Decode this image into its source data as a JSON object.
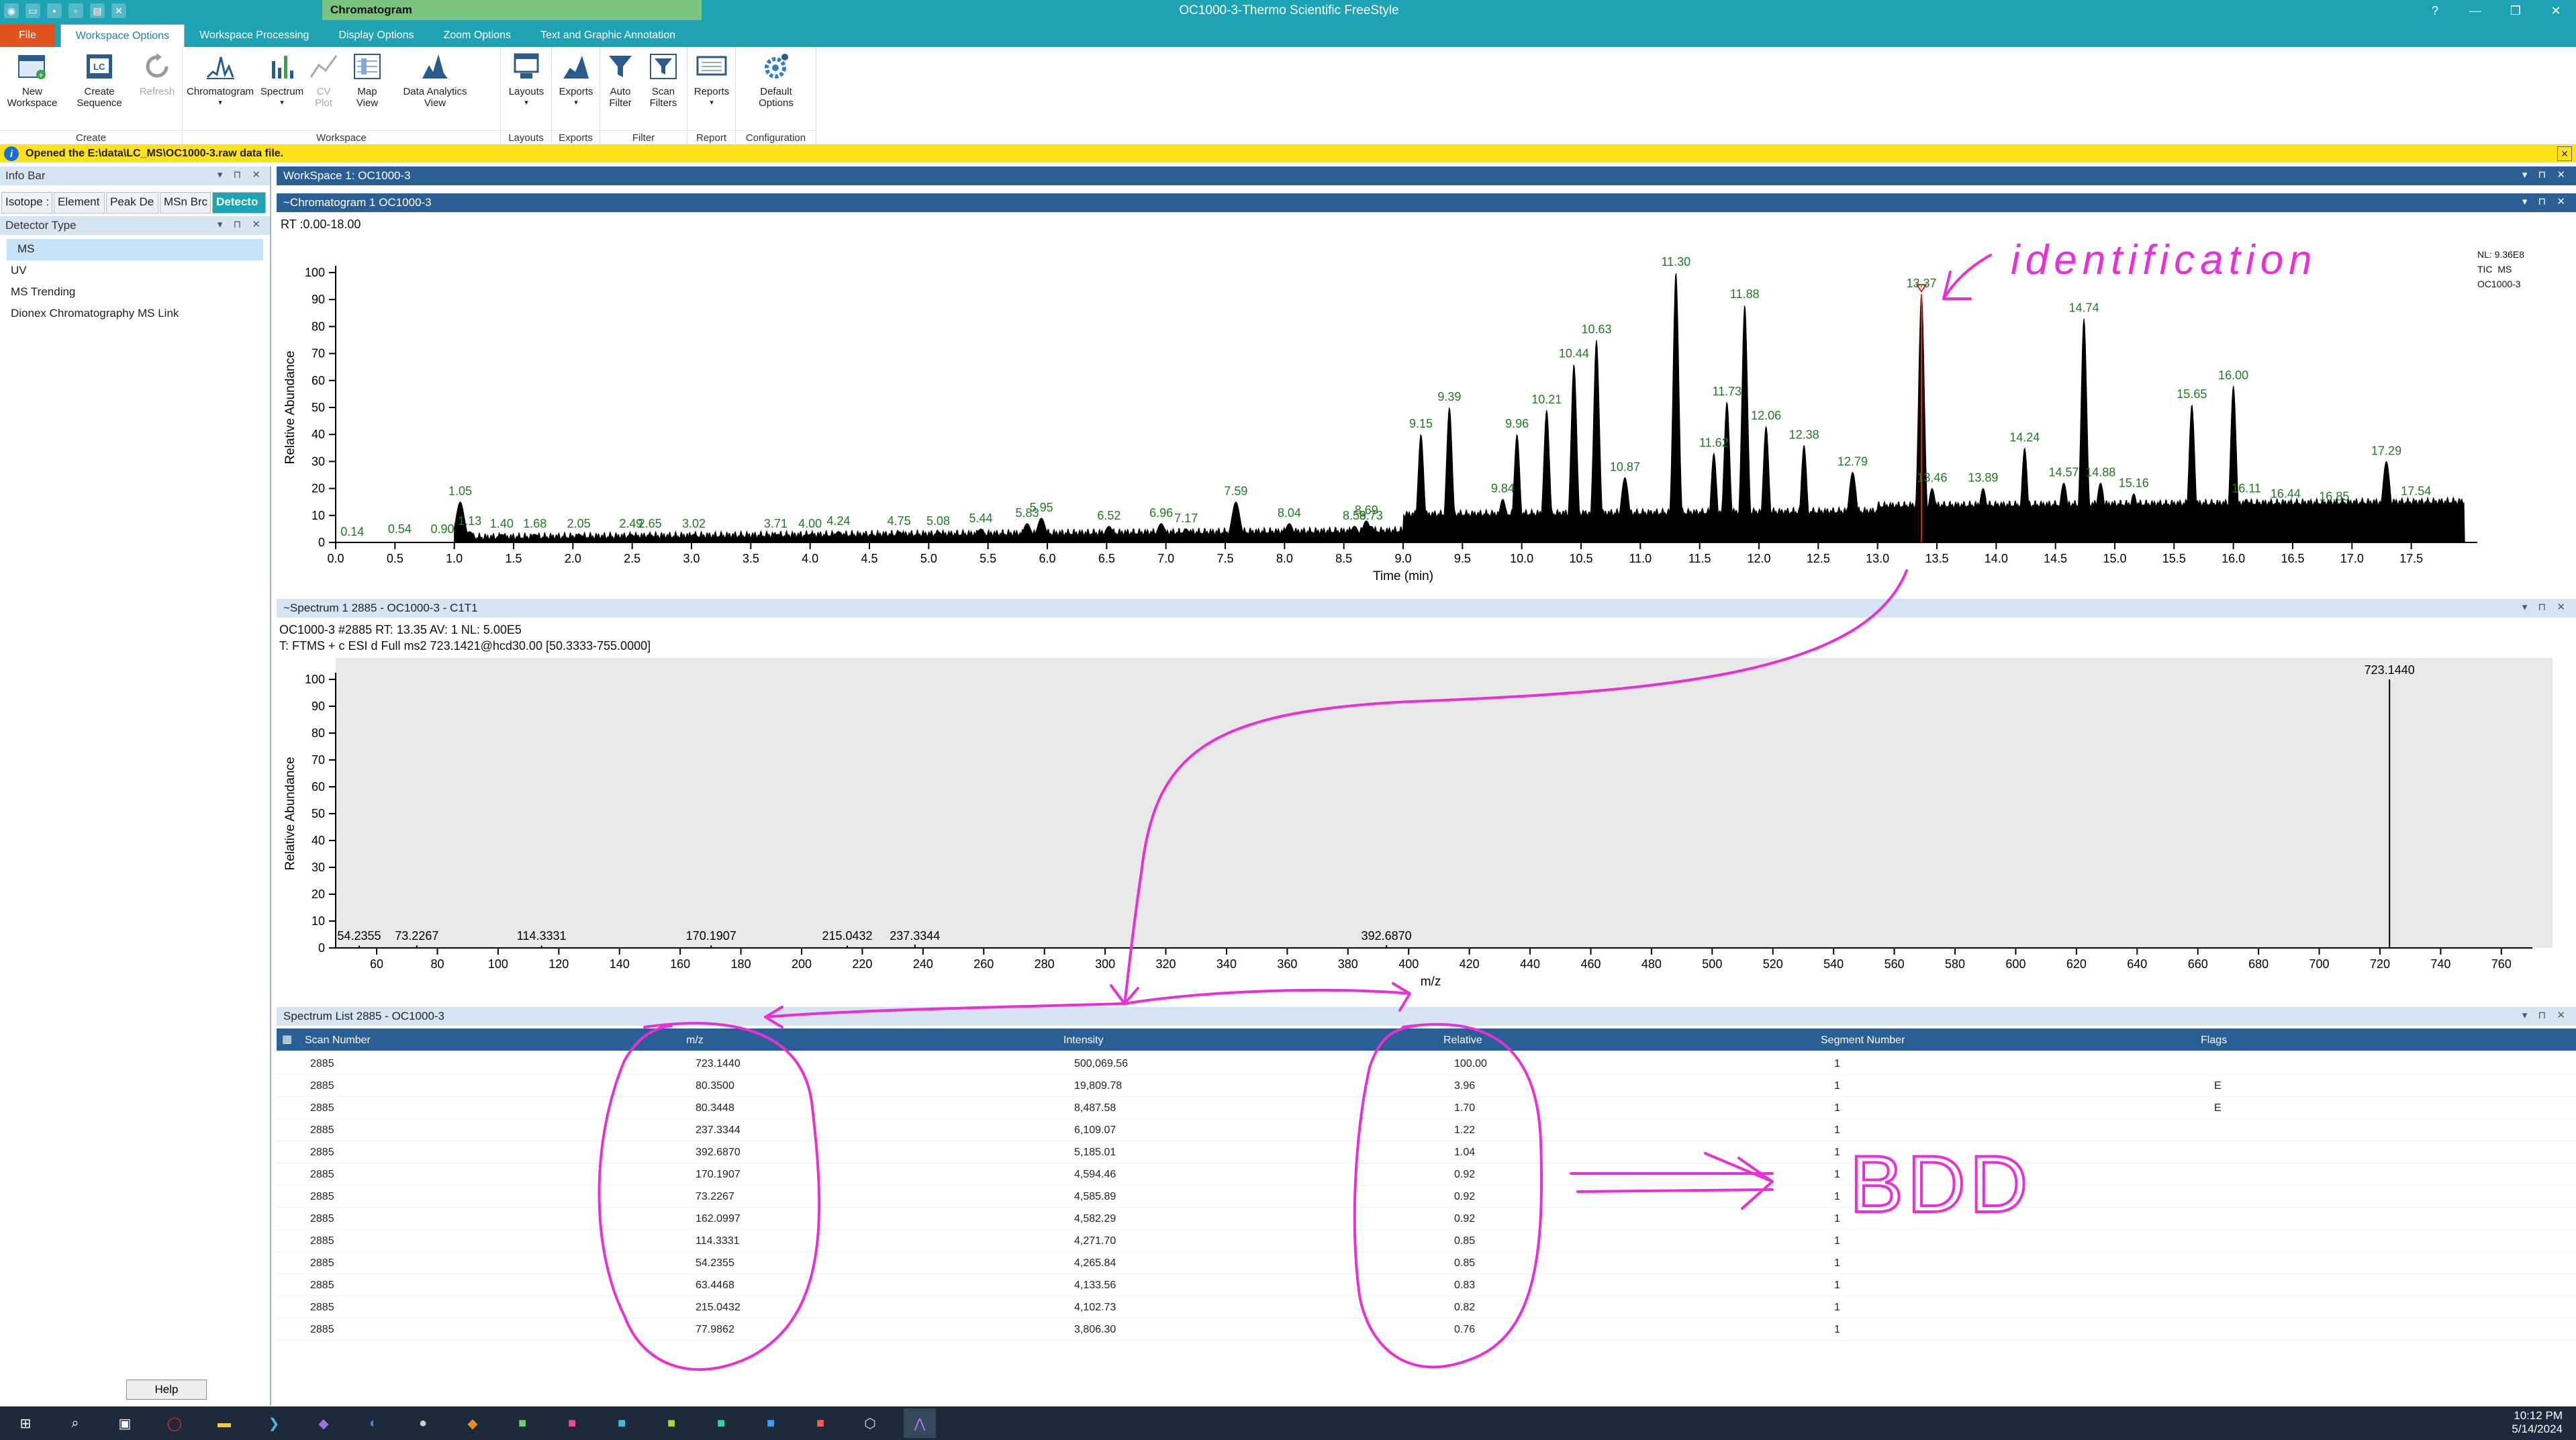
{
  "titlebar": {
    "app_title": "OC1000-3-Thermo Scientific FreeStyle",
    "context_tab": "Chromatogram",
    "quick_access": [
      "app-icon",
      "open-icon",
      "save-icon",
      "save-as-icon",
      "print-icon",
      "tools-icon"
    ]
  },
  "ribbon_tabs": [
    "File",
    "Workspace Options",
    "Workspace Processing",
    "Display Options",
    "Zoom Options",
    "Text and Graphic Annotation"
  ],
  "ribbon": {
    "buttons": {
      "new_workspace": "New\nWorkspace",
      "create_sequence": "Create\nSequence",
      "refresh": "Refresh",
      "chromatogram": "Chromatogram",
      "spectrum": "Spectrum",
      "cv_plot": "CV\nPlot",
      "map_view": "Map\nView",
      "data_analytics": "Data Analytics\nView",
      "layouts": "Layouts",
      "exports": "Exports",
      "auto_filter": "Auto\nFilter",
      "scan_filters": "Scan\nFilters",
      "reports": "Reports",
      "default_options": "Default\nOptions"
    },
    "groups": {
      "create": "Create",
      "workspace": "Workspace",
      "layouts": "Layouts",
      "exports": "Exports",
      "filter": "Filter",
      "report": "Report",
      "configuration": "Configuration"
    }
  },
  "infobar": {
    "message": "Opened the E:\\data\\LC_MS\\OC1000-3.raw data file."
  },
  "left_pane": {
    "title": "Info Bar",
    "tabs": [
      "Isotope :",
      "Element",
      "Peak De",
      "MSn Brc",
      "Detecto"
    ],
    "detector_title": "Detector Type",
    "detector_items": [
      "MS",
      "UV",
      "MS Trending",
      "Dionex Chromatography MS Link"
    ],
    "help": "Help"
  },
  "workspace": {
    "title": "WorkSpace 1: OC1000-3",
    "chrom_panel_title": "~Chromatogram  1  OC1000-3",
    "spectrum_panel_title": "~Spectrum  1  2885 - OC1000-3 - C1T1",
    "list_panel_title": "Spectrum List  2885 - OC1000-3"
  },
  "chromatogram": {
    "rt_range": "RT :0.00-18.00",
    "nl_lines": [
      "NL: 9.36E8",
      "TIC  MS",
      "OC1000-3"
    ],
    "ylabel": "Relative Abundance",
    "xlabel": "Time (min)",
    "yticks": [
      "100",
      "90",
      "80",
      "70",
      "60",
      "50",
      "40",
      "30",
      "20",
      "10",
      "0"
    ],
    "xticks": [
      "0.0",
      "0.5",
      "1.0",
      "1.5",
      "2.0",
      "2.5",
      "3.0",
      "3.5",
      "4.0",
      "4.5",
      "5.0",
      "5.5",
      "6.0",
      "6.5",
      "7.0",
      "7.5",
      "8.0",
      "8.5",
      "9.0",
      "9.5",
      "10.0",
      "10.5",
      "11.0",
      "11.5",
      "12.0",
      "12.5",
      "13.0",
      "13.5",
      "14.0",
      "14.5",
      "15.0",
      "15.5",
      "16.0",
      "16.5",
      "17.0",
      "17.5"
    ],
    "peaks": [
      {
        "rt": "0.14",
        "x": 0.14,
        "y": 0
      },
      {
        "rt": "0.54",
        "x": 0.54,
        "y": 1
      },
      {
        "rt": "0.90",
        "x": 0.9,
        "y": 1
      },
      {
        "rt": "1.05",
        "x": 1.05,
        "y": 15
      },
      {
        "rt": "1.13",
        "x": 1.13,
        "y": 4
      },
      {
        "rt": "1.40",
        "x": 1.4,
        "y": 3
      },
      {
        "rt": "1.68",
        "x": 1.68,
        "y": 3
      },
      {
        "rt": "2.05",
        "x": 2.05,
        "y": 3
      },
      {
        "rt": "2.49",
        "x": 2.49,
        "y": 3
      },
      {
        "rt": "2.65",
        "x": 2.65,
        "y": 3
      },
      {
        "rt": "3.02",
        "x": 3.02,
        "y": 3
      },
      {
        "rt": "3.71",
        "x": 3.71,
        "y": 3
      },
      {
        "rt": "4.00",
        "x": 4.0,
        "y": 3
      },
      {
        "rt": "4.24",
        "x": 4.24,
        "y": 4
      },
      {
        "rt": "4.75",
        "x": 4.75,
        "y": 4
      },
      {
        "rt": "5.08",
        "x": 5.08,
        "y": 4
      },
      {
        "rt": "5.44",
        "x": 5.44,
        "y": 5
      },
      {
        "rt": "5.83",
        "x": 5.83,
        "y": 7
      },
      {
        "rt": "5.95",
        "x": 5.95,
        "y": 9
      },
      {
        "rt": "6.52",
        "x": 6.52,
        "y": 6
      },
      {
        "rt": "6.96",
        "x": 6.96,
        "y": 7
      },
      {
        "rt": "7.17",
        "x": 7.17,
        "y": 5
      },
      {
        "rt": "7.59",
        "x": 7.59,
        "y": 15
      },
      {
        "rt": "8.04",
        "x": 8.04,
        "y": 7
      },
      {
        "rt": "8.59",
        "x": 8.59,
        "y": 6
      },
      {
        "rt": "8.69",
        "x": 8.69,
        "y": 8
      },
      {
        "rt": "8.73",
        "x": 8.73,
        "y": 6
      },
      {
        "rt": "9.15",
        "x": 9.15,
        "y": 40
      },
      {
        "rt": "9.39",
        "x": 9.39,
        "y": 50
      },
      {
        "rt": "9.84",
        "x": 9.84,
        "y": 16
      },
      {
        "rt": "9.96",
        "x": 9.96,
        "y": 40
      },
      {
        "rt": "10.21",
        "x": 10.21,
        "y": 49
      },
      {
        "rt": "10.44",
        "x": 10.44,
        "y": 66
      },
      {
        "rt": "10.63",
        "x": 10.63,
        "y": 75
      },
      {
        "rt": "10.87",
        "x": 10.87,
        "y": 24
      },
      {
        "rt": "11.30",
        "x": 11.3,
        "y": 100
      },
      {
        "rt": "11.62",
        "x": 11.62,
        "y": 33
      },
      {
        "rt": "11.73",
        "x": 11.73,
        "y": 52
      },
      {
        "rt": "11.88",
        "x": 11.88,
        "y": 88
      },
      {
        "rt": "12.06",
        "x": 12.06,
        "y": 43
      },
      {
        "rt": "12.38",
        "x": 12.38,
        "y": 36
      },
      {
        "rt": "12.79",
        "x": 12.79,
        "y": 26
      },
      {
        "rt": "13.37",
        "x": 13.37,
        "y": 92
      },
      {
        "rt": "13.46",
        "x": 13.46,
        "y": 20
      },
      {
        "rt": "13.89",
        "x": 13.89,
        "y": 20
      },
      {
        "rt": "14.24",
        "x": 14.24,
        "y": 35
      },
      {
        "rt": "14.57",
        "x": 14.57,
        "y": 22
      },
      {
        "rt": "14.74",
        "x": 14.74,
        "y": 83
      },
      {
        "rt": "14.88",
        "x": 14.88,
        "y": 22
      },
      {
        "rt": "15.16",
        "x": 15.16,
        "y": 18
      },
      {
        "rt": "15.65",
        "x": 15.65,
        "y": 51
      },
      {
        "rt": "16.00",
        "x": 16.0,
        "y": 58
      },
      {
        "rt": "16.11",
        "x": 16.11,
        "y": 16
      },
      {
        "rt": "16.44",
        "x": 16.44,
        "y": 14
      },
      {
        "rt": "16.85",
        "x": 16.85,
        "y": 13
      },
      {
        "rt": "17.29",
        "x": 17.29,
        "y": 30
      },
      {
        "rt": "17.54",
        "x": 17.54,
        "y": 15
      }
    ]
  },
  "spectrum": {
    "header1": "OC1000-3 #2885 RT: 13.35 AV: 1 NL: 5.00E5",
    "header2": "T: FTMS + c ESI d Full ms2 723.1421@hcd30.00 [50.3333-755.0000]",
    "ylabel": "Relative Abundance",
    "xlabel": "m/z",
    "yticks": [
      "100",
      "90",
      "80",
      "70",
      "60",
      "50",
      "40",
      "30",
      "20",
      "10",
      "0"
    ],
    "xticks": [
      "60",
      "80",
      "100",
      "120",
      "140",
      "160",
      "180",
      "200",
      "220",
      "240",
      "260",
      "280",
      "300",
      "320",
      "340",
      "360",
      "380",
      "400",
      "420",
      "440",
      "460",
      "480",
      "500",
      "520",
      "540",
      "560",
      "580",
      "600",
      "620",
      "640",
      "660",
      "680",
      "700",
      "720",
      "740",
      "760"
    ],
    "peaks": [
      {
        "label": "54.2355",
        "mz": 54.2355,
        "rel": 0.85
      },
      {
        "label": "73.2267",
        "mz": 73.2267,
        "rel": 0.92
      },
      {
        "label": "114.3331",
        "mz": 114.3331,
        "rel": 0.85
      },
      {
        "label": "170.1907",
        "mz": 170.1907,
        "rel": 0.92
      },
      {
        "label": "215.0432",
        "mz": 215.0432,
        "rel": 0.82
      },
      {
        "label": "237.3344",
        "mz": 237.3344,
        "rel": 1.22
      },
      {
        "label": "392.6870",
        "mz": 392.687,
        "rel": 1.04
      },
      {
        "label": "723.1440",
        "mz": 723.144,
        "rel": 100.0
      }
    ]
  },
  "table": {
    "columns": [
      "Scan Number",
      "m/z",
      "Intensity",
      "Relative",
      "Segment Number",
      "Flags"
    ],
    "rows": [
      [
        "2885",
        "723.1440",
        "500,069.56",
        "100.00",
        "1",
        ""
      ],
      [
        "2885",
        "80.3500",
        "19,809.78",
        "3.96",
        "1",
        "E"
      ],
      [
        "2885",
        "80.3448",
        "8,487.58",
        "1.70",
        "1",
        "E"
      ],
      [
        "2885",
        "237.3344",
        "6,109.07",
        "1.22",
        "1",
        ""
      ],
      [
        "2885",
        "392.6870",
        "5,185.01",
        "1.04",
        "1",
        ""
      ],
      [
        "2885",
        "170.1907",
        "4,594.46",
        "0.92",
        "1",
        ""
      ],
      [
        "2885",
        "73.2267",
        "4,585.89",
        "0.92",
        "1",
        ""
      ],
      [
        "2885",
        "162.0997",
        "4,582.29",
        "0.92",
        "1",
        ""
      ],
      [
        "2885",
        "114.3331",
        "4,271.70",
        "0.85",
        "1",
        ""
      ],
      [
        "2885",
        "54.2355",
        "4,265.84",
        "0.85",
        "1",
        ""
      ],
      [
        "2885",
        "63.4468",
        "4,133.56",
        "0.83",
        "1",
        ""
      ],
      [
        "2885",
        "215.0432",
        "4,102.73",
        "0.82",
        "1",
        ""
      ],
      [
        "2885",
        "77.9862",
        "3,806.30",
        "0.76",
        "1",
        ""
      ]
    ]
  },
  "annotations": {
    "identification": "identification",
    "bdd": "BDD",
    "ink_color": "#e830d6"
  },
  "taskbar": {
    "time": "10:12 PM",
    "date": "5/14/2024"
  },
  "colors": {
    "accent": "#1da3b3",
    "file_tab": "#e2521f",
    "infobar": "#ffe11a",
    "peak_label": "#1f7a1f",
    "panel_dark": "#2a5f96"
  }
}
